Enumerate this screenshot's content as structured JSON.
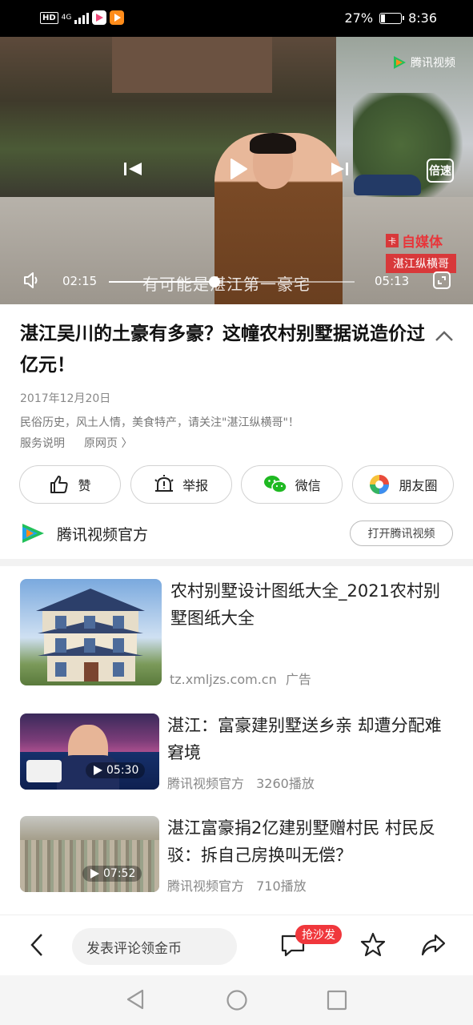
{
  "status_bar": {
    "hd": "HD",
    "network": "4G",
    "battery_percent": "27%",
    "battery_level": 0.27,
    "time": "8:36"
  },
  "video": {
    "watermark": "腾讯视频",
    "channel_badge_logo": "卡",
    "channel_badge_title": "自媒体",
    "channel_badge_sub": "湛江纵横哥",
    "subtitle": "有可能是湛江第一豪宅",
    "current_time": "02:15",
    "duration": "05:13",
    "progress": 0.43,
    "speed_label": "倍速"
  },
  "article": {
    "title": "湛江吴川的土豪有多豪？这幢农村别墅据说造价过亿元！",
    "date": "2017年12月20日",
    "description": "民俗历史，风土人情，美食特产，请关注\"湛江纵横哥\"！",
    "service_link": "服务说明",
    "source_link": "原网页 〉"
  },
  "actions": {
    "like": "赞",
    "report": "举报",
    "wechat": "微信",
    "moments": "朋友圈"
  },
  "channel": {
    "name": "腾讯视频官方",
    "open_button": "打开腾讯视频"
  },
  "feed": [
    {
      "title": "农村别墅设计图纸大全_2021农村别墅图纸大全",
      "source": "tz.xmljzs.com.cn",
      "tag": "广告"
    },
    {
      "title": "湛江：富豪建别墅送乡亲 却遭分配难窘境",
      "source": "腾讯视频官方",
      "plays": "3260播放",
      "duration": "05:30"
    },
    {
      "title": "湛江富豪捐2亿建别墅赠村民 村民反驳：拆自己房换叫无偿？",
      "source": "腾讯视频官方",
      "plays": "710播放",
      "duration": "07:52"
    }
  ],
  "bottom_bar": {
    "comment_placeholder": "发表评论领金币",
    "sofa_badge": "抢沙发"
  },
  "colors": {
    "accent_red": "#f0373c",
    "tencent_green": "#22c05a",
    "tencent_blue": "#1fa3ea",
    "tencent_orange": "#ff8c1a"
  }
}
